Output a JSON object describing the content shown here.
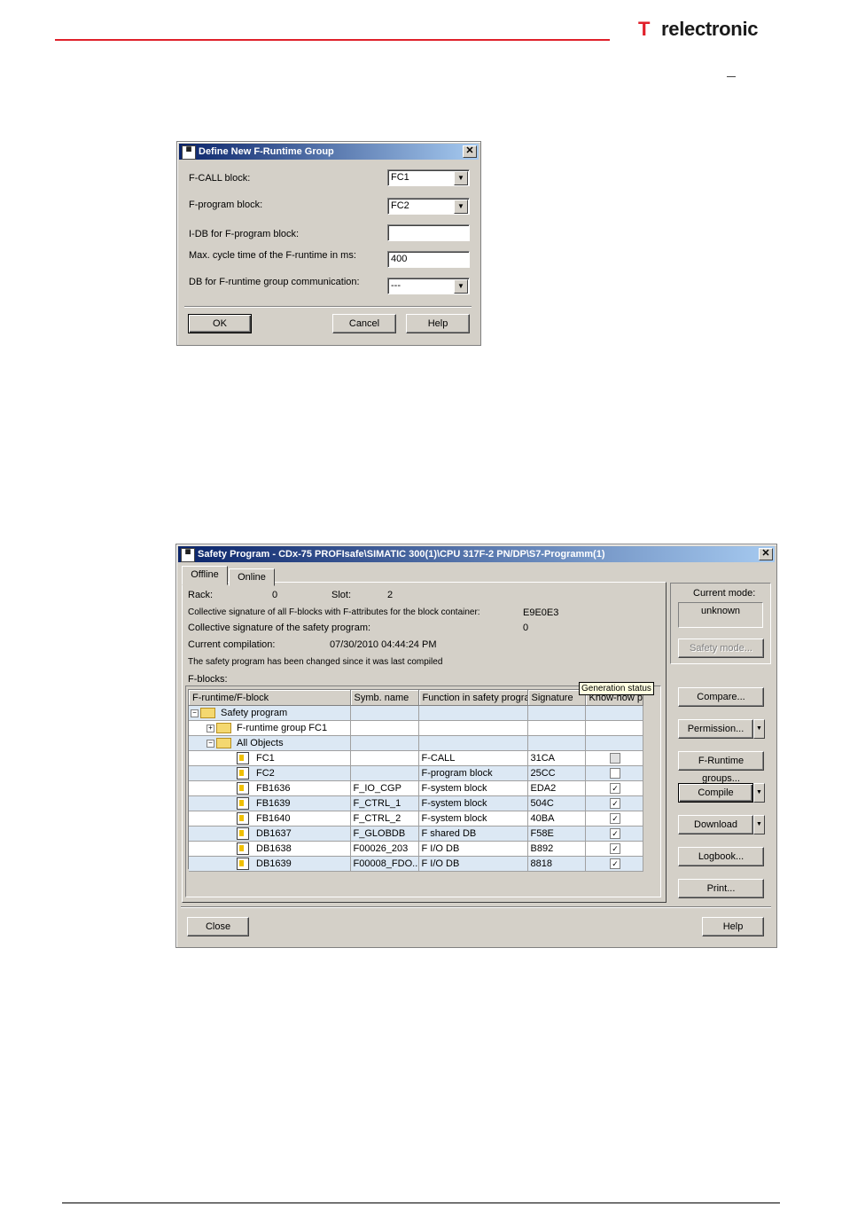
{
  "header": {
    "logo_mark": "T",
    "logo_text": "relectronic"
  },
  "dialog1": {
    "title": "Define New F-Runtime Group",
    "fcall_label": "F-CALL block:",
    "fcall_value": "FC1",
    "fprog_label": "F-program block:",
    "fprog_value": "FC2",
    "idb_label": "I-DB for F-program block:",
    "idb_value": "",
    "cycle_label": "Max. cycle time of the F-runtime in ms:",
    "cycle_value": "400",
    "db_label": "DB for F-runtime group communication:",
    "db_value": "---",
    "ok": "OK",
    "cancel": "Cancel",
    "help": "Help"
  },
  "dialog2": {
    "title": "Safety Program - CDx-75 PROFIsafe\\SIMATIC 300(1)\\CPU 317F-2 PN/DP\\S7-Programm(1)",
    "tabs": {
      "offline": "Offline",
      "online": "Online"
    },
    "rack_label": "Rack:",
    "rack_value": "0",
    "slot_label": "Slot:",
    "slot_value": "2",
    "collective_fblocks_label": "Collective signature of all F-blocks with F-attributes for the block container:",
    "collective_fblocks_value": "E9E0E3",
    "collective_safety_label": "Collective signature of the safety program:",
    "collective_safety_value": "0",
    "compilation_label": "Current compilation:",
    "compilation_value": "07/30/2010 04:44:24 PM",
    "changed_msg": "The safety program has been changed since it was last compiled",
    "fblocks_label": "F-blocks:",
    "tooltip": "Generation status",
    "columns": [
      "F-runtime/F-block",
      "Symb. name",
      "Function in safety program",
      "Signature",
      "Know-how p"
    ],
    "rows": [
      {
        "level": 0,
        "icon": "folder",
        "pm": "−",
        "name": "Safety program",
        "symb": "",
        "func": "",
        "sig": "",
        "kh": ""
      },
      {
        "level": 1,
        "icon": "folder",
        "pm": "+",
        "name": "F-runtime group FC1",
        "symb": "",
        "func": "",
        "sig": "",
        "kh": ""
      },
      {
        "level": 1,
        "icon": "folder",
        "pm": "−",
        "name": "All Objects",
        "symb": "",
        "func": "",
        "sig": "",
        "kh": ""
      },
      {
        "level": 2,
        "icon": "block",
        "name": "FC1",
        "symb": "",
        "func": "F-CALL",
        "sig": "31CA",
        "kh": "disabled"
      },
      {
        "level": 2,
        "icon": "block",
        "name": "FC2",
        "symb": "",
        "func": "F-program block",
        "sig": "25CC",
        "kh": "unchecked"
      },
      {
        "level": 2,
        "icon": "block",
        "name": "FB1636",
        "symb": "F_IO_CGP",
        "func": "F-system block",
        "sig": "EDA2",
        "kh": "checked"
      },
      {
        "level": 2,
        "icon": "block",
        "name": "FB1639",
        "symb": "F_CTRL_1",
        "func": "F-system block",
        "sig": "504C",
        "kh": "checked"
      },
      {
        "level": 2,
        "icon": "block",
        "name": "FB1640",
        "symb": "F_CTRL_2",
        "func": "F-system block",
        "sig": "40BA",
        "kh": "checked"
      },
      {
        "level": 2,
        "icon": "block",
        "name": "DB1637",
        "symb": "F_GLOBDB",
        "func": "F shared DB",
        "sig": "F58E",
        "kh": "checked"
      },
      {
        "level": 2,
        "icon": "block",
        "name": "DB1638",
        "symb": "F00026_203",
        "func": "F I/O DB",
        "sig": "B892",
        "kh": "checked"
      },
      {
        "level": 2,
        "icon": "block",
        "name": "DB1639",
        "symb": "F00008_FDO...",
        "func": "F I/O DB",
        "sig": "8818",
        "kh": "checked"
      }
    ],
    "mode_label": "Current mode:",
    "mode_value": "unknown",
    "safety_mode": "Safety mode...",
    "compare": "Compare...",
    "permission": "Permission...",
    "runtime_groups": "F-Runtime groups...",
    "compile": "Compile",
    "download": "Download",
    "logbook": "Logbook...",
    "print": "Print...",
    "close": "Close",
    "help": "Help"
  }
}
